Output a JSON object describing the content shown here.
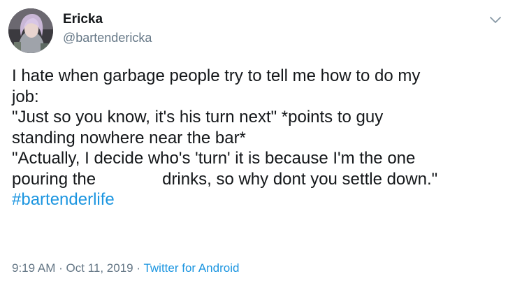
{
  "tweet": {
    "author_name": "Ericka",
    "author_handle": "@bartendericka",
    "more_icon": "chevron-down-icon",
    "avatar_icon": "user-avatar",
    "lines": [
      "I hate when garbage people try to tell me how to do my",
      "job:",
      "\"Just so you know, it's his turn next\" *points to guy",
      "standing nowhere near the bar*",
      "\"Actually, I decide who's 'turn' it is because I'm the one"
    ],
    "line6_before": "pouring the",
    "line6_after": "drinks, so why dont you settle down.\"",
    "hashtag": "#bartenderlife",
    "time": "9:19 AM",
    "separator": "·",
    "date": "Oct 11, 2019",
    "source": "Twitter for Android",
    "colors": {
      "link": "#1b95e0",
      "secondary": "#657786",
      "text": "#14171a"
    }
  }
}
